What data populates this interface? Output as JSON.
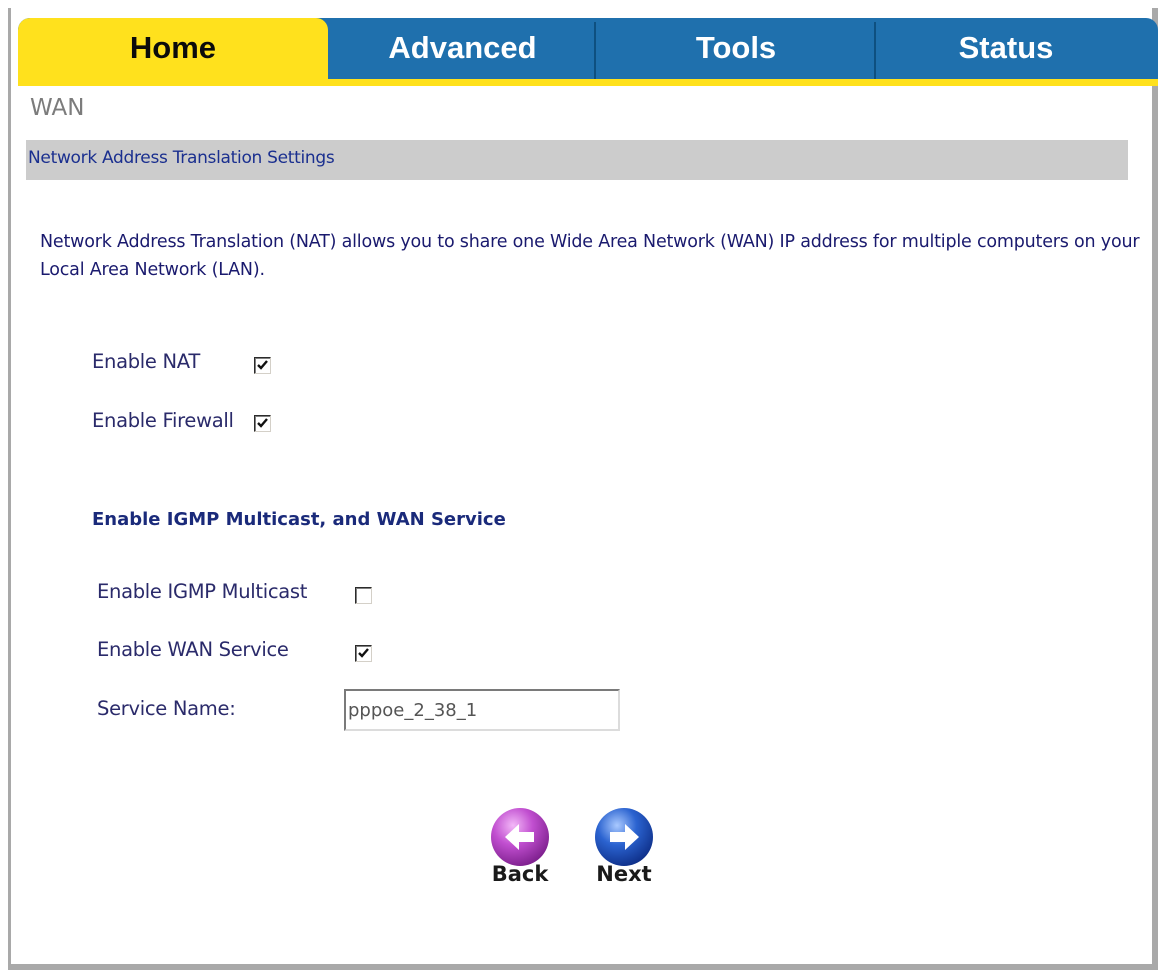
{
  "tabs": [
    {
      "label": "Home",
      "active": true
    },
    {
      "label": "Advanced",
      "active": false
    },
    {
      "label": "Tools",
      "active": false
    },
    {
      "label": "Status",
      "active": false
    }
  ],
  "page": {
    "title": "WAN"
  },
  "section": {
    "title": "Network Address Translation Settings",
    "description": "Network Address Translation (NAT) allows you to share one Wide Area Network (WAN) IP address for multiple computers on your Local Area Network (LAN)."
  },
  "options": {
    "enable_nat": {
      "label": "Enable NAT",
      "checked": true
    },
    "enable_firewall": {
      "label": "Enable Firewall",
      "checked": true
    }
  },
  "multicast_section": {
    "heading": "Enable IGMP Multicast, and WAN Service",
    "enable_igmp": {
      "label": "Enable IGMP Multicast",
      "checked": false
    },
    "enable_wan_service": {
      "label": "Enable WAN Service",
      "checked": true
    },
    "service_name": {
      "label": "Service Name:",
      "value": "pppoe_2_38_1"
    }
  },
  "navigation": {
    "back_label": "Back",
    "next_label": "Next"
  },
  "colors": {
    "tab_active": "#ffe11d",
    "tab_inactive": "#1f70ad",
    "section_bar": "#cccccc",
    "back_button": "#b944c8",
    "next_button": "#1f4fb8"
  },
  "icons": {
    "back": "left-arrow-circle-icon",
    "next": "right-arrow-circle-icon"
  }
}
